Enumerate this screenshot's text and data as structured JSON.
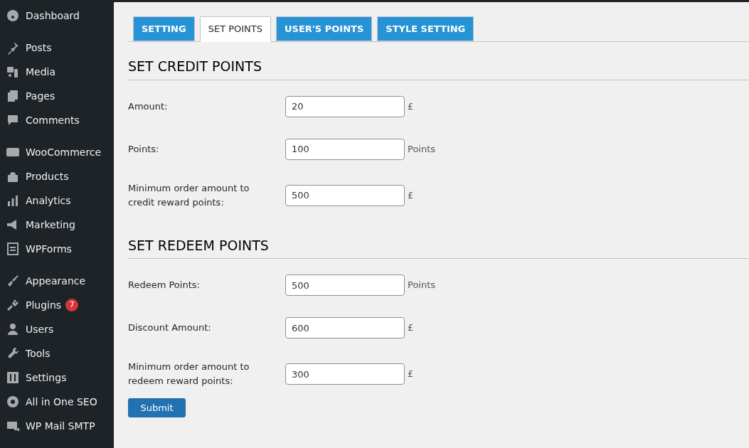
{
  "sidebar": {
    "groups": [
      [
        {
          "label": "Dashboard"
        }
      ],
      [
        {
          "label": "Posts"
        },
        {
          "label": "Media"
        },
        {
          "label": "Pages"
        },
        {
          "label": "Comments"
        }
      ],
      [
        {
          "label": "WooCommerce"
        },
        {
          "label": "Products"
        },
        {
          "label": "Analytics"
        },
        {
          "label": "Marketing"
        },
        {
          "label": "WPForms"
        }
      ],
      [
        {
          "label": "Appearance"
        },
        {
          "label": "Plugins",
          "badge": "7"
        },
        {
          "label": "Users"
        },
        {
          "label": "Tools"
        },
        {
          "label": "Settings"
        },
        {
          "label": "All in One SEO"
        },
        {
          "label": "WP Mail SMTP"
        }
      ]
    ]
  },
  "tabs": [
    {
      "label": "SETTING",
      "selected": false
    },
    {
      "label": "SET POINTS",
      "selected": true
    },
    {
      "label": "USER'S POINTS",
      "selected": false
    },
    {
      "label": "STYLE SETTING",
      "selected": false
    }
  ],
  "sections": [
    {
      "title": "SET CREDIT POINTS",
      "fields": [
        {
          "label": "Amount:",
          "value": "20",
          "unit": "£"
        },
        {
          "label": "Points:",
          "value": "100",
          "unit": "Points"
        },
        {
          "label": "Minimum order amount to credit reward points:",
          "value": "500",
          "unit": "£"
        }
      ]
    },
    {
      "title": "SET REDEEM POINTS",
      "fields": [
        {
          "label": "Redeem Points:",
          "value": "500",
          "unit": "Points"
        },
        {
          "label": "Discount Amount:",
          "value": "600",
          "unit": "£"
        },
        {
          "label": "Minimum order amount to redeem reward points:",
          "value": "300",
          "unit": "£"
        }
      ]
    }
  ],
  "submit": "Submit"
}
